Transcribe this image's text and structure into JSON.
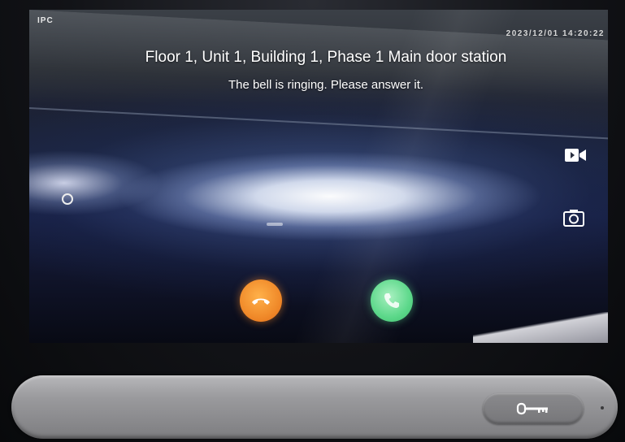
{
  "status_bar": {
    "left": "IPC",
    "datetime": "2023/12/01 14:20:22"
  },
  "call": {
    "title": "Floor 1, Unit 1, Building 1, Phase 1 Main door station",
    "message": "The bell is ringing. Please answer it."
  },
  "icons": {
    "record": "video-camera-icon",
    "snapshot": "camera-icon",
    "hangup": "phone-hangup-icon",
    "answer": "phone-answer-icon",
    "unlock": "key-icon"
  },
  "colors": {
    "hangup": "#f08a2a",
    "answer": "#5cd88a"
  }
}
